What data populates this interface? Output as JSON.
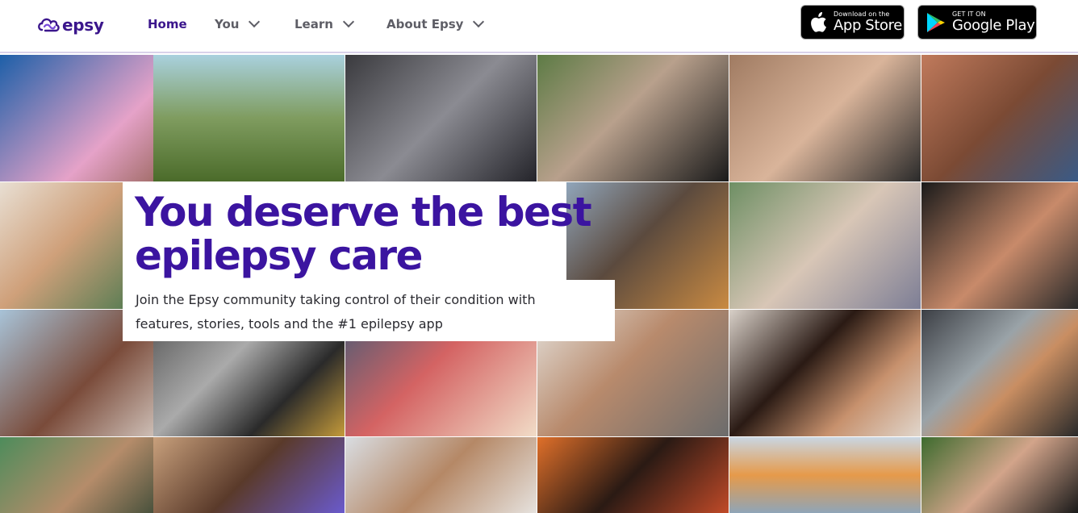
{
  "brand": {
    "name": "epsy",
    "color": "#3b168c"
  },
  "nav": {
    "items": [
      {
        "label": "Home",
        "active": true
      },
      {
        "label": "You",
        "dropdown": true
      },
      {
        "label": "Learn",
        "dropdown": true
      },
      {
        "label": "About Epsy",
        "dropdown": true
      }
    ]
  },
  "stores": {
    "apple": {
      "small": "Download on the",
      "big": "App Store"
    },
    "google": {
      "small": "GET IT ON",
      "big": "Google Play"
    }
  },
  "hero": {
    "headline_line1": "You deserve the best",
    "headline_line2": "epilepsy care",
    "subtext_line1": "Join the Epsy community taking control of their condition with",
    "subtext_line2": "features, stories, tools and the #1 epilepsy app",
    "accent": "#3b14a0"
  },
  "photos": [
    "community-photo",
    "community-photo",
    "community-photo",
    "community-photo",
    "community-photo",
    "community-photo",
    "community-photo",
    "community-photo",
    "community-photo",
    "community-photo",
    "community-photo",
    "community-photo",
    "community-photo",
    "community-photo",
    "community-photo",
    "community-photo",
    "community-photo",
    "community-photo",
    "community-photo",
    "community-photo",
    "community-photo",
    "community-photo",
    "community-photo",
    "community-photo"
  ]
}
